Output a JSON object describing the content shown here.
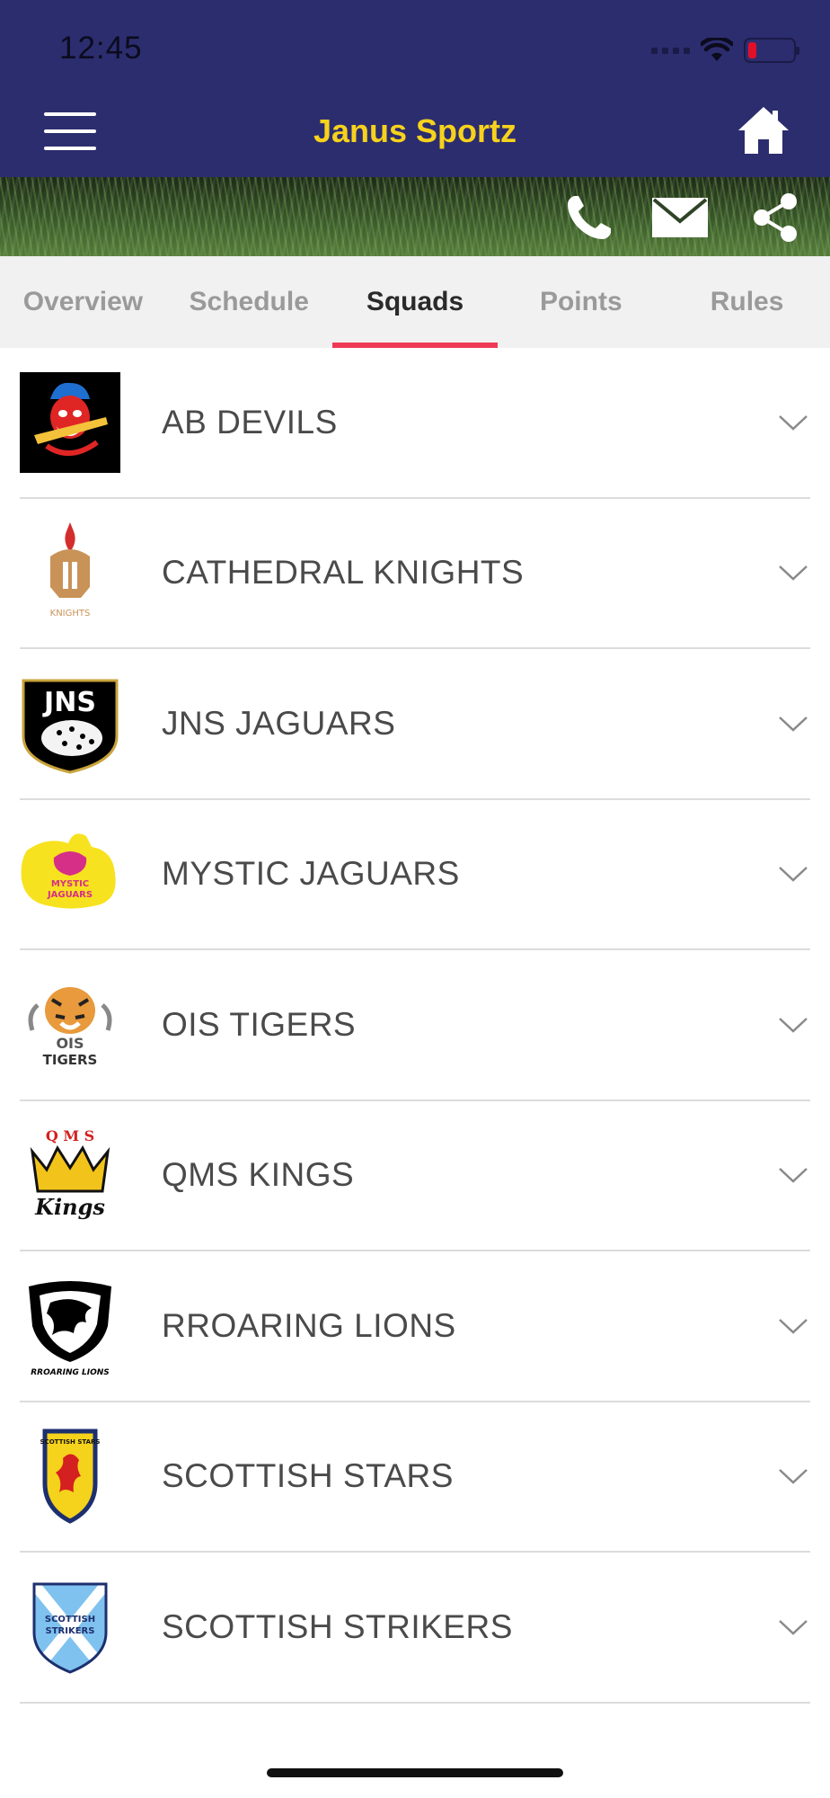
{
  "status": {
    "time": "12:45"
  },
  "header": {
    "title": "Janus Sportz",
    "accent": "#f7d21c",
    "background": "#2c2d6e"
  },
  "tabs": [
    {
      "label": "Overview"
    },
    {
      "label": "Schedule"
    },
    {
      "label": "Squads",
      "active": true
    },
    {
      "label": "Points"
    },
    {
      "label": "Rules"
    }
  ],
  "teams": [
    {
      "name": "AB DEVILS",
      "logo": "devil-logo-icon"
    },
    {
      "name": "CATHEDRAL KNIGHTS",
      "logo": "knight-helmet-logo-icon",
      "logo_text": "KNIGHTS"
    },
    {
      "name": "JNS JAGUARS",
      "logo": "jaguar-shield-logo-icon",
      "logo_text": "JNS"
    },
    {
      "name": "MYSTIC JAGUARS",
      "logo": "mystic-jaguar-logo-icon",
      "logo_text": "MYSTIC JAGUARS"
    },
    {
      "name": "OIS TIGERS",
      "logo": "tiger-logo-icon",
      "logo_text": "OIS TIGERS"
    },
    {
      "name": "QMS KINGS",
      "logo": "crown-logo-icon",
      "logo_text": "QMS Kings"
    },
    {
      "name": "RROARING LIONS",
      "logo": "lion-shield-logo-icon",
      "logo_text": "RROARING LIONS"
    },
    {
      "name": "SCOTTISH STARS",
      "logo": "lion-rampant-shield-logo-icon",
      "logo_text": "SCOTTISH STARS"
    },
    {
      "name": "SCOTTISH STRIKERS",
      "logo": "saltire-shield-logo-icon",
      "logo_text": "SCOTTISH STRIKERS"
    }
  ]
}
